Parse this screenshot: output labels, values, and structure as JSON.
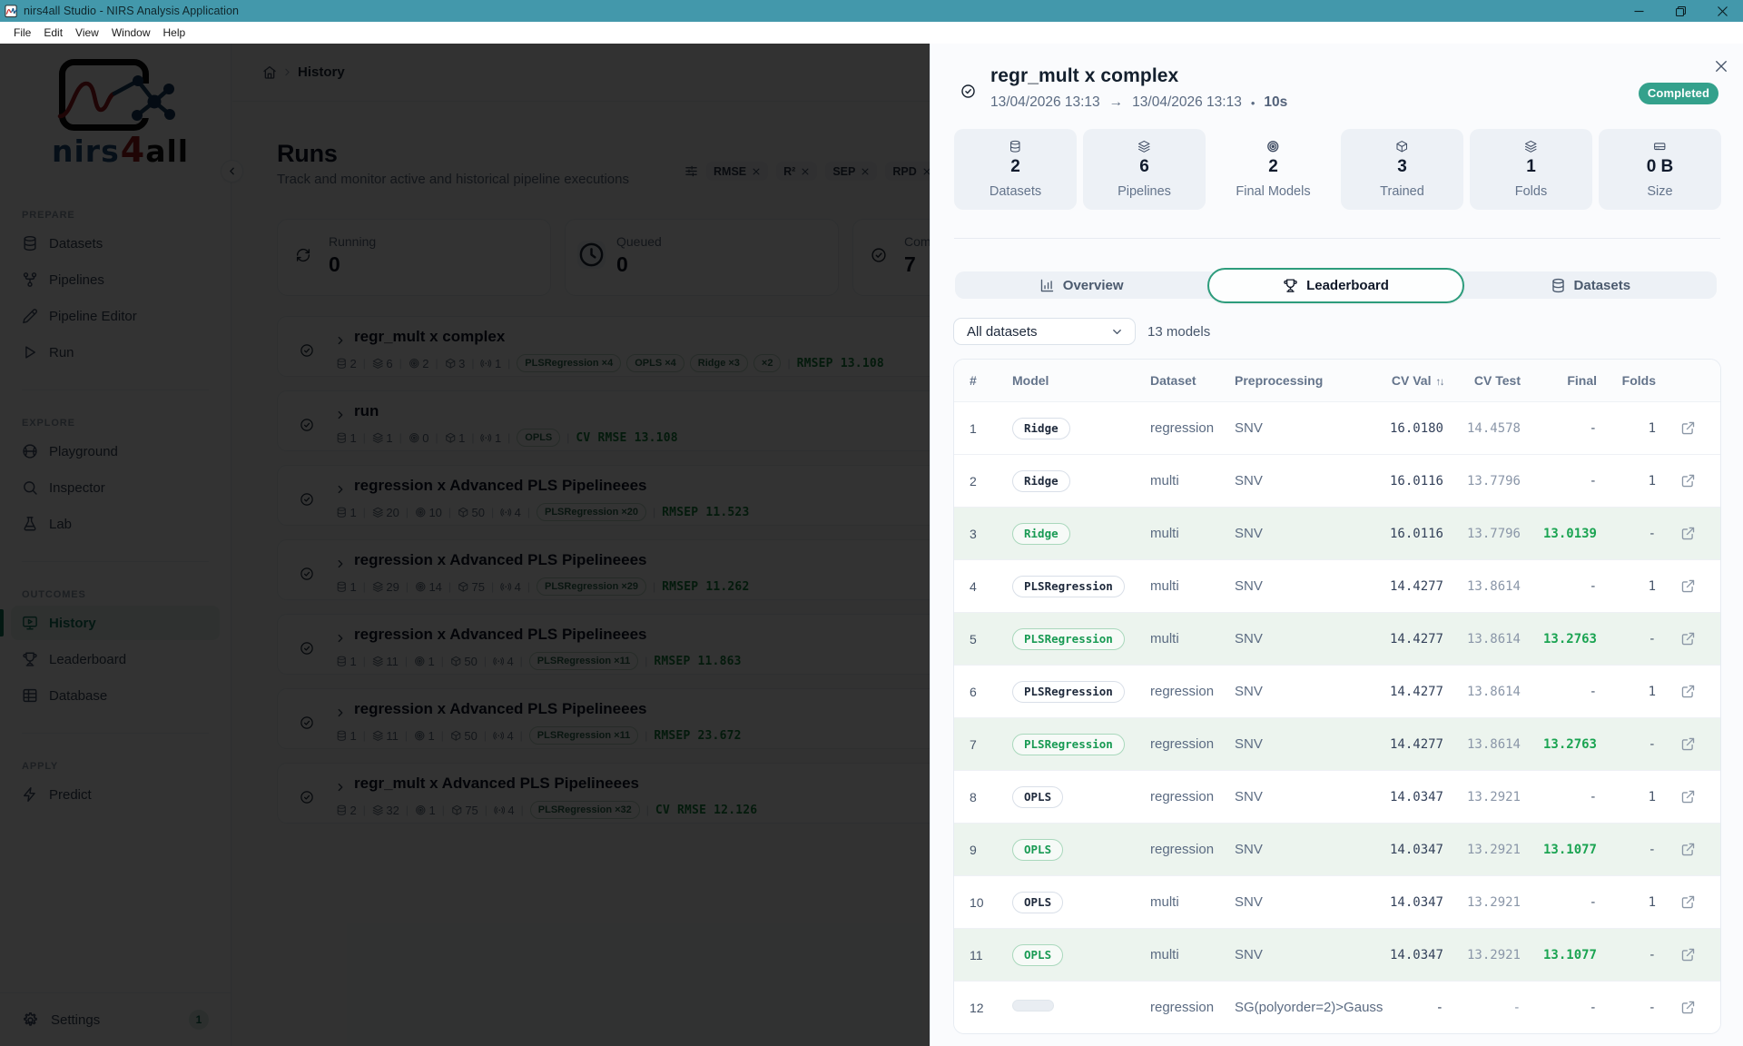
{
  "window": {
    "title": "nirs4all Studio - NIRS Analysis Application",
    "menus": [
      "File",
      "Edit",
      "View",
      "Window",
      "Help"
    ]
  },
  "logo": {
    "nirs": "nirs",
    "four": "4",
    "all": "all"
  },
  "sidebar": {
    "sections": [
      {
        "label": "PREPARE",
        "items": [
          {
            "label": "Datasets",
            "icon": "database"
          },
          {
            "label": "Pipelines",
            "icon": "git-fork"
          },
          {
            "label": "Pipeline Editor",
            "icon": "pencil"
          },
          {
            "label": "Run",
            "icon": "play"
          }
        ]
      },
      {
        "label": "EXPLORE",
        "items": [
          {
            "label": "Playground",
            "icon": "ball"
          },
          {
            "label": "Inspector",
            "icon": "search"
          },
          {
            "label": "Lab",
            "icon": "flask"
          }
        ]
      },
      {
        "label": "OUTCOMES",
        "items": [
          {
            "label": "History",
            "icon": "monitor-play",
            "active": true
          },
          {
            "label": "Leaderboard",
            "icon": "trophy"
          },
          {
            "label": "Database",
            "icon": "table"
          }
        ]
      },
      {
        "label": "APPLY",
        "items": [
          {
            "label": "Predict",
            "icon": "zap"
          }
        ]
      }
    ],
    "settings": {
      "label": "Settings",
      "badge": "1"
    }
  },
  "breadcrumb": {
    "page": "History"
  },
  "main": {
    "title": "Runs",
    "subtitle": "Track and monitor active and historical pipeline executions",
    "filters": [
      "RMSE",
      "R²",
      "SEP",
      "RPD"
    ],
    "stats": [
      {
        "label": "Running",
        "value": "0",
        "icon": "refresh",
        "chip": false
      },
      {
        "label": "Queued",
        "value": "0",
        "icon": "clock",
        "chip": true
      },
      {
        "label": "Completed",
        "value": "7",
        "icon": "check-circle",
        "chip": false
      }
    ],
    "runs": [
      {
        "name": "regr_mult x complex",
        "counts": [
          "2",
          "6",
          "2",
          "3",
          "1"
        ],
        "chips": [
          "PLSRegression ×4",
          "OPLS ×4",
          "Ridge ×3",
          "×2"
        ],
        "metric": "RMSEP 13.108"
      },
      {
        "name": "run",
        "counts": [
          "1",
          "1",
          "0",
          "1",
          "1"
        ],
        "chips": [
          "OPLS"
        ],
        "metric": "CV RMSE 13.108"
      },
      {
        "name": "regression x Advanced PLS Pipelineees",
        "counts": [
          "1",
          "20",
          "10",
          "50",
          "4"
        ],
        "chips": [
          "PLSRegression ×20"
        ],
        "metric": "RMSEP 11.523"
      },
      {
        "name": "regression x Advanced PLS Pipelineees",
        "counts": [
          "1",
          "29",
          "14",
          "75",
          "4"
        ],
        "chips": [
          "PLSRegression ×29"
        ],
        "metric": "RMSEP 11.262"
      },
      {
        "name": "regression x Advanced PLS Pipelineees",
        "counts": [
          "1",
          "11",
          "1",
          "50",
          "4"
        ],
        "chips": [
          "PLSRegression ×11"
        ],
        "metric": "RMSEP 11.863"
      },
      {
        "name": "regression x Advanced PLS Pipelineees",
        "counts": [
          "1",
          "11",
          "1",
          "50",
          "4"
        ],
        "chips": [
          "PLSRegression ×11"
        ],
        "metric": "RMSEP 23.672"
      },
      {
        "name": "regr_mult x Advanced PLS Pipelineees",
        "counts": [
          "2",
          "32",
          "1",
          "75",
          "4"
        ],
        "chips": [
          "PLSRegression ×32"
        ],
        "metric": "CV RMSE 12.126"
      }
    ]
  },
  "panel": {
    "title": "regr_mult x complex",
    "time_start": "13/04/2026 13:13",
    "time_arrow": "→",
    "time_end": "13/04/2026 13:13",
    "time_dot": "•",
    "duration": "10s",
    "status": "Completed",
    "stats": [
      {
        "value": "2",
        "label": "Datasets",
        "icon": "database",
        "plain": false
      },
      {
        "value": "6",
        "label": "Pipelines",
        "icon": "layers",
        "plain": false
      },
      {
        "value": "2",
        "label": "Final Models",
        "icon": "target",
        "plain": true
      },
      {
        "value": "3",
        "label": "Trained",
        "icon": "box",
        "plain": false
      },
      {
        "value": "1",
        "label": "Folds",
        "icon": "layers",
        "plain": false
      },
      {
        "value": "0 B",
        "label": "Size",
        "icon": "hard-drive",
        "plain": false
      }
    ],
    "tabs": [
      {
        "label": "Overview",
        "icon": "bar-chart",
        "active": false
      },
      {
        "label": "Leaderboard",
        "icon": "trophy",
        "active": true
      },
      {
        "label": "Datasets",
        "icon": "database",
        "active": false
      }
    ],
    "dataset_filter": "All datasets",
    "models_count": "13 models",
    "sort_glyph": "↑↓",
    "table": {
      "columns": [
        "#",
        "Model",
        "Dataset",
        "Preprocessing",
        "CV Val",
        "CV Test",
        "Final",
        "Folds"
      ],
      "rows": [
        {
          "rank": "1",
          "model": "Ridge",
          "dataset": "regression",
          "preprocessing": "SNV",
          "cv_val": "16.0180",
          "cv_test": "14.4578",
          "final": "-",
          "folds": "1",
          "highlight": false
        },
        {
          "rank": "2",
          "model": "Ridge",
          "dataset": "multi",
          "preprocessing": "SNV",
          "cv_val": "16.0116",
          "cv_test": "13.7796",
          "final": "-",
          "folds": "1",
          "highlight": false
        },
        {
          "rank": "3",
          "model": "Ridge",
          "dataset": "multi",
          "preprocessing": "SNV",
          "cv_val": "16.0116",
          "cv_test": "13.7796",
          "final": "13.0139",
          "folds": "-",
          "highlight": true
        },
        {
          "rank": "4",
          "model": "PLSRegression",
          "dataset": "multi",
          "preprocessing": "SNV",
          "cv_val": "14.4277",
          "cv_test": "13.8614",
          "final": "-",
          "folds": "1",
          "highlight": false
        },
        {
          "rank": "5",
          "model": "PLSRegression",
          "dataset": "multi",
          "preprocessing": "SNV",
          "cv_val": "14.4277",
          "cv_test": "13.8614",
          "final": "13.2763",
          "folds": "-",
          "highlight": true
        },
        {
          "rank": "6",
          "model": "PLSRegression",
          "dataset": "regression",
          "preprocessing": "SNV",
          "cv_val": "14.4277",
          "cv_test": "13.8614",
          "final": "-",
          "folds": "1",
          "highlight": false
        },
        {
          "rank": "7",
          "model": "PLSRegression",
          "dataset": "regression",
          "preprocessing": "SNV",
          "cv_val": "14.4277",
          "cv_test": "13.8614",
          "final": "13.2763",
          "folds": "-",
          "highlight": true
        },
        {
          "rank": "8",
          "model": "OPLS",
          "dataset": "regression",
          "preprocessing": "SNV",
          "cv_val": "14.0347",
          "cv_test": "13.2921",
          "final": "-",
          "folds": "1",
          "highlight": false
        },
        {
          "rank": "9",
          "model": "OPLS",
          "dataset": "regression",
          "preprocessing": "SNV",
          "cv_val": "14.0347",
          "cv_test": "13.2921",
          "final": "13.1077",
          "folds": "-",
          "highlight": true
        },
        {
          "rank": "10",
          "model": "OPLS",
          "dataset": "multi",
          "preprocessing": "SNV",
          "cv_val": "14.0347",
          "cv_test": "13.2921",
          "final": "-",
          "folds": "1",
          "highlight": false
        },
        {
          "rank": "11",
          "model": "OPLS",
          "dataset": "multi",
          "preprocessing": "SNV",
          "cv_val": "14.0347",
          "cv_test": "13.2921",
          "final": "13.1077",
          "folds": "-",
          "highlight": true
        },
        {
          "rank": "12",
          "model": "",
          "dataset": "regression",
          "preprocessing": "SG(polyorder=2)>Gauss",
          "cv_val": "-",
          "cv_test": "-",
          "final": "-",
          "folds": "-",
          "highlight": false
        }
      ]
    }
  },
  "colors": {
    "titlebar": "#4398ab",
    "accent_teal": "#2ba189",
    "accent_green": "#1ba452",
    "active_nav": "#157a5e"
  }
}
